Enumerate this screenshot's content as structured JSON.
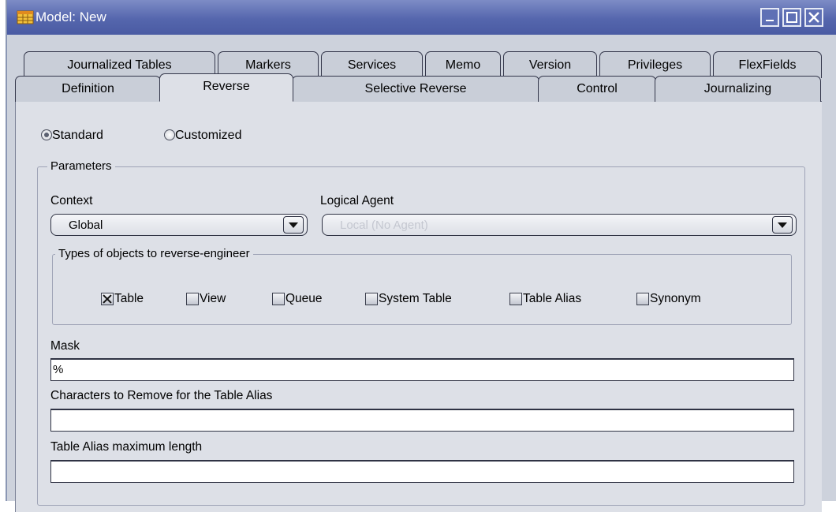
{
  "window": {
    "title": "Model: New",
    "icon": "model-table-icon",
    "controls": [
      "minimize-icon",
      "maximize-icon",
      "close-icon"
    ]
  },
  "tabs": {
    "row1": [
      "Journalized Tables",
      "Markers",
      "Services",
      "Memo",
      "Version",
      "Privileges",
      "FlexFields"
    ],
    "row2": [
      "Definition",
      "Reverse",
      "Selective Reverse",
      "Control",
      "Journalizing"
    ],
    "active": "Reverse"
  },
  "mode": {
    "standard_label": "Standard",
    "customized_label": "Customized",
    "selected": "Standard"
  },
  "parameters": {
    "legend": "Parameters",
    "context_label": "Context",
    "context_value": "Global",
    "logical_agent_label": "Logical Agent",
    "logical_agent_value": "Local (No Agent)",
    "types_legend": "Types of objects to reverse-engineer",
    "types": [
      {
        "label": "Table",
        "checked": true
      },
      {
        "label": "View",
        "checked": false
      },
      {
        "label": "Queue",
        "checked": false
      },
      {
        "label": "System Table",
        "checked": false
      },
      {
        "label": "Table Alias",
        "checked": false
      },
      {
        "label": "Synonym",
        "checked": false
      }
    ],
    "mask_label": "Mask",
    "mask_value": "%",
    "chars_remove_label": "Characters to Remove for the Table Alias",
    "chars_remove_value": "",
    "alias_max_label": "Table Alias maximum length",
    "alias_max_value": ""
  },
  "colors": {
    "titlebar": "#5566ad",
    "panel": "#dde0e7",
    "tab": "#c9ced8"
  }
}
